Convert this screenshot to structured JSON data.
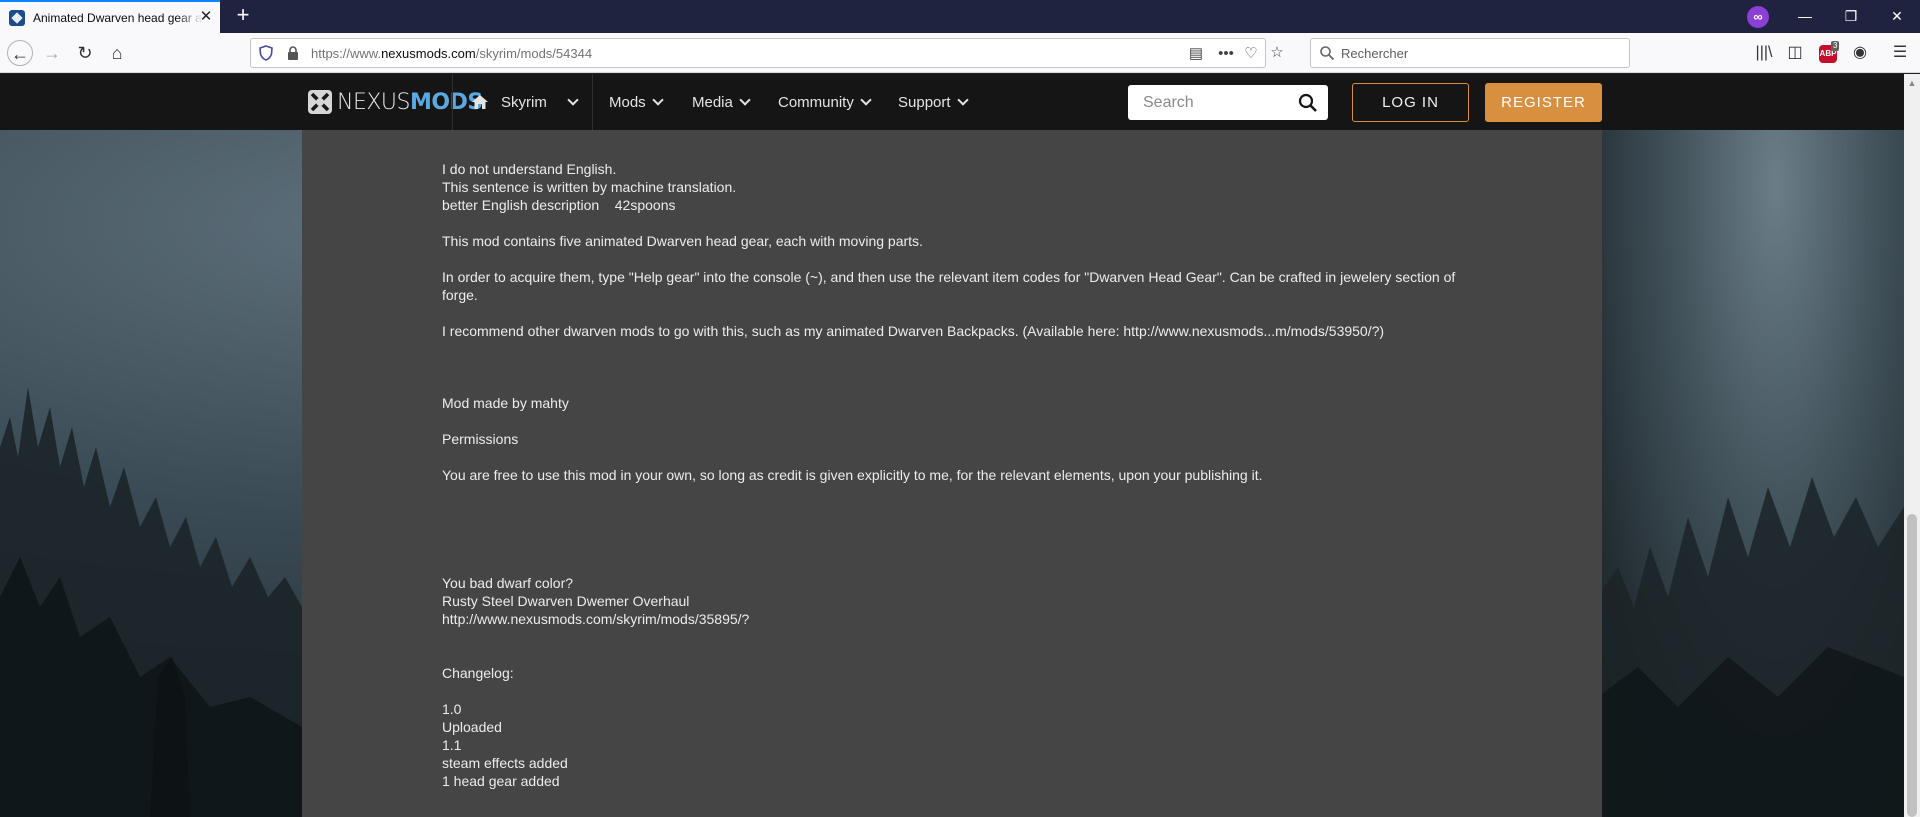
{
  "browser": {
    "tab_title": "Animated Dwarven head gear a",
    "url_prefix": "https://www.",
    "url_domain": "nexusmods.com",
    "url_path": "/skyrim/mods/54344",
    "search_placeholder": "Rechercher",
    "abp_count": "3",
    "abp_label": "ABP"
  },
  "site": {
    "logo_nexus": "NEXUS",
    "logo_mods": "MODS",
    "nav": [
      {
        "label": "Skyrim"
      },
      {
        "label": "Mods"
      },
      {
        "label": "Media"
      },
      {
        "label": "Community"
      },
      {
        "label": "Support"
      }
    ],
    "search_placeholder": "Search",
    "login_label": "LOG IN",
    "register_label": "REGISTER"
  },
  "description": {
    "lines": [
      "I do not understand English.",
      "This sentence is written by machine translation.",
      "better English description    42spoons",
      "This mod contains five animated Dwarven head gear, each with moving parts.",
      "In order to acquire them, type \"Help gear\" into the console (~), and then use the relevant item codes for \"Dwarven Head Gear\". Can be crafted in jewelery section of forge.",
      "I recommend other dwarven mods to go with this, such as my animated Dwarven Backpacks. (Available here: http://www.nexusmods...m/mods/53950/?)",
      "Mod made by mahty",
      "Permissions",
      "You are free to use this mod in your own, so long as credit is given explicitly to me, for the relevant elements, upon your publishing it.",
      "You bad dwarf color?",
      "Rusty Steel Dwarven Dwemer Overhaul",
      "http://www.nexusmods.com/skyrim/mods/35895/?",
      "Changelog:",
      "1.0",
      "Uploaded",
      "1.1",
      "steam effects added",
      "1 head gear added"
    ]
  }
}
